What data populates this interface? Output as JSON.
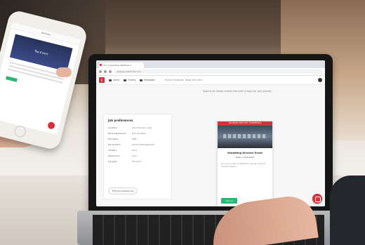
{
  "browser": {
    "tab_title": "Your marketing dashboard",
    "url": "eagleeyenetworks.com"
  },
  "app": {
    "logo": "E",
    "nav": [
      "Home",
      "Events",
      "Messages"
    ],
    "search_placeholder": "Search hangouts, blogs and more",
    "search_hint": "Search for whole events the past 4 days (or any period)"
  },
  "preferences": {
    "title": "Job preferences",
    "rows": [
      {
        "label": "Location",
        "value": "San Francisco Area"
      },
      {
        "label": "Work experience",
        "value": "8 to 10 years"
      },
      {
        "label": "Education",
        "value": "MBA"
      },
      {
        "label": "Job function",
        "value": "Product Management"
      },
      {
        "label": "Industry",
        "value": "Tech"
      },
      {
        "label": "Headcount",
        "value": "501+"
      },
      {
        "label": "Job type",
        "value": "Full time"
      }
    ],
    "edit_label": "Edit job preferences"
  },
  "card": {
    "header": "UPCOMING INDUSTRY CONFERENCE",
    "title": "Marketing Director Event",
    "subtitle": "Date: 12/12/2020",
    "text": "Join us for a day of networking and learning from industry leaders.",
    "primary": "Sign up",
    "secondary": "Ignore"
  },
  "phone": {
    "title": "Welcome",
    "banner": "Top Event"
  },
  "colors": {
    "brand": "#d2323a",
    "primary_button": "#2bb673"
  },
  "icons": [
    "home-icon",
    "chat-icon",
    "message-icon",
    "search-icon",
    "avatar-icon",
    "fab-icon"
  ]
}
